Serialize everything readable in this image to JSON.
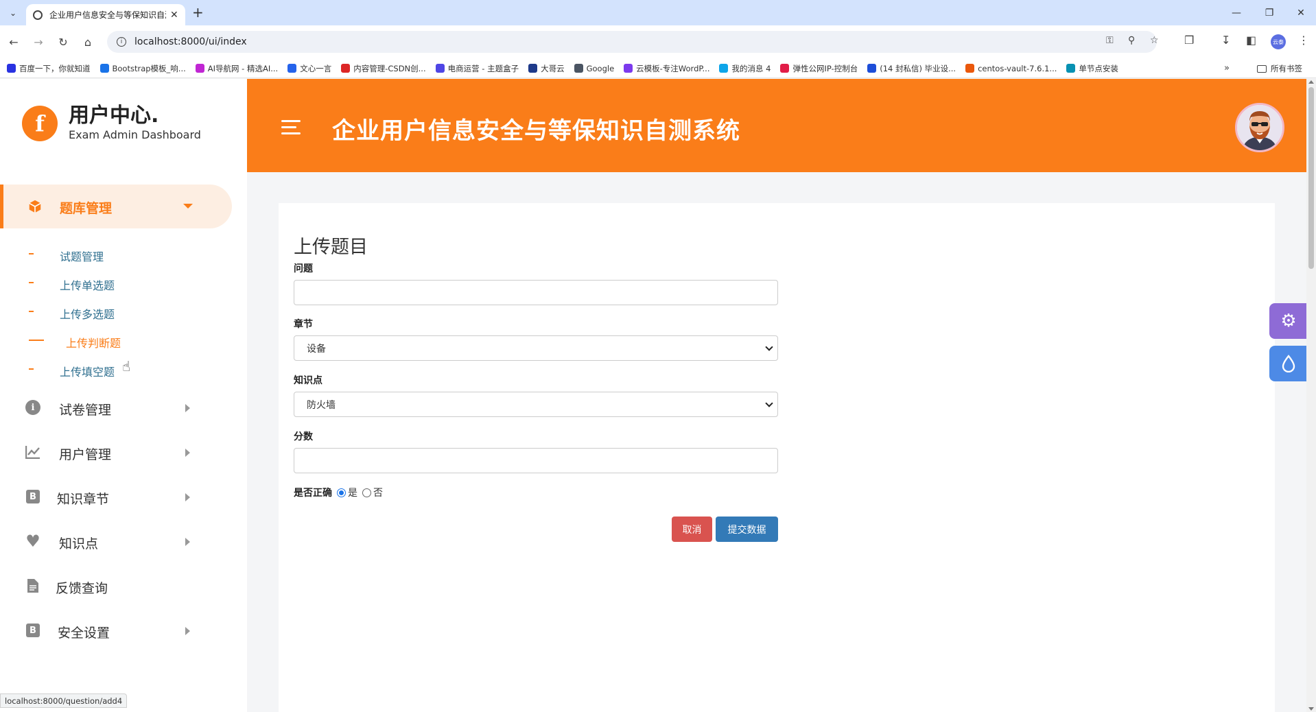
{
  "browser": {
    "tab_title": "企业用户信息安全与等保知识自测系统",
    "url": "localhost:8000/ui/index",
    "status_url": "localhost:8000/question/add4",
    "profile_label": "云泰",
    "bookmarks": [
      {
        "label": "百度一下，你就知道",
        "color": "#2932e1"
      },
      {
        "label": "Bootstrap模板_响...",
        "color": "#1a73e8"
      },
      {
        "label": "AI导航网 - 精选AI...",
        "color": "#c026d3"
      },
      {
        "label": "文心一言",
        "color": "#2563eb"
      },
      {
        "label": "内容管理-CSDN创...",
        "color": "#dc2626"
      },
      {
        "label": "电商运营 - 主题盒子",
        "color": "#4f46e5"
      },
      {
        "label": "大哥云",
        "color": "#1e3a8a"
      },
      {
        "label": "Google",
        "color": "#4b5563"
      },
      {
        "label": "云模板-专注WordP...",
        "color": "#7c3aed"
      },
      {
        "label": "我的消息 4",
        "color": "#0ea5e9"
      },
      {
        "label": "弹性公网IP-控制台",
        "color": "#e11d48"
      },
      {
        "label": "(14 封私信) 毕业设...",
        "color": "#1d4ed8"
      },
      {
        "label": "centos-vault-7.6.1...",
        "color": "#ea580c"
      },
      {
        "label": "单节点安装",
        "color": "#0891b2"
      }
    ],
    "all_bookmarks": "所有书签"
  },
  "brand": {
    "logo_letter": "f",
    "title": "用户中心.",
    "subtitle": "Exam Admin Dashboard"
  },
  "sidebar": {
    "active_menu": {
      "label": "题库管理",
      "icon": "cube-icon"
    },
    "submenu": [
      {
        "label": "试题管理",
        "active": false
      },
      {
        "label": "上传单选题",
        "active": false
      },
      {
        "label": "上传多选题",
        "active": false
      },
      {
        "label": "上传判断题",
        "active": true
      },
      {
        "label": "上传填空题",
        "active": false
      }
    ],
    "menus": [
      {
        "label": "试卷管理",
        "icon": "info-icon"
      },
      {
        "label": "用户管理",
        "icon": "chart-icon"
      },
      {
        "label": "知识章节",
        "icon": "bold-b-icon"
      },
      {
        "label": "知识点",
        "icon": "heart-icon"
      },
      {
        "label": "反馈查询",
        "icon": "document-icon"
      },
      {
        "label": "安全设置",
        "icon": "bold-b-icon"
      }
    ]
  },
  "header": {
    "title": "企业用户信息安全与等保知识自测系统"
  },
  "form": {
    "title": "上传题目",
    "question_label": "问题",
    "question_value": "",
    "chapter_label": "章节",
    "chapter_selected": "设备",
    "knowledge_label": "知识点",
    "knowledge_selected": "防火墙",
    "score_label": "分数",
    "score_value": "",
    "correct_label": "是否正确",
    "option_yes": "是",
    "option_no": "否",
    "correct_selected": "是",
    "cancel_label": "取消",
    "submit_label": "提交数据"
  },
  "colors": {
    "accent": "#fa7d19",
    "cancel": "#d9534f",
    "submit": "#337ab7",
    "gear_float": "#8e6bd6",
    "drop_float": "#4d8ae6"
  }
}
